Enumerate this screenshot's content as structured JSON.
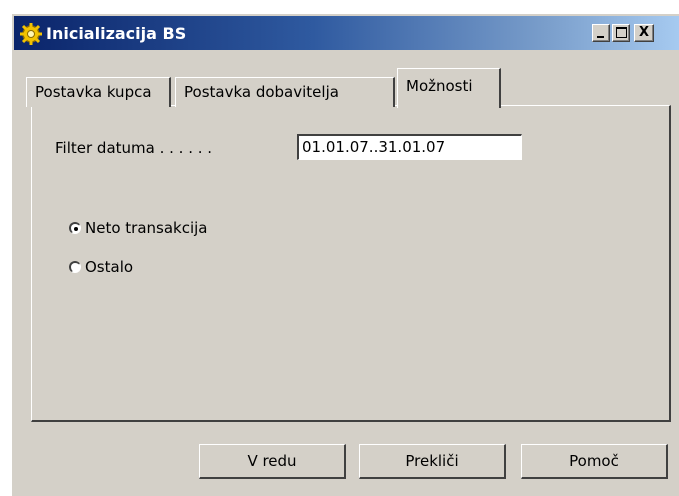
{
  "window": {
    "title": "Inicializacija BS",
    "controls": {
      "minimize": "_",
      "maximize": "□",
      "close": "X"
    }
  },
  "tabs": [
    {
      "label": "Postavka kupca",
      "selected": false
    },
    {
      "label": "Postavka dobavitelja",
      "selected": false
    },
    {
      "label": "Možnosti",
      "selected": true
    }
  ],
  "filter": {
    "label": "Filter datuma . . . . . .",
    "value": "01.01.07..31.01.07"
  },
  "options": [
    {
      "label": "Neto transakcija",
      "checked": true
    },
    {
      "label": "Ostalo",
      "checked": false
    }
  ],
  "buttons": {
    "ok": "V redu",
    "cancel": "Prekliči",
    "help": "Pomoč"
  }
}
